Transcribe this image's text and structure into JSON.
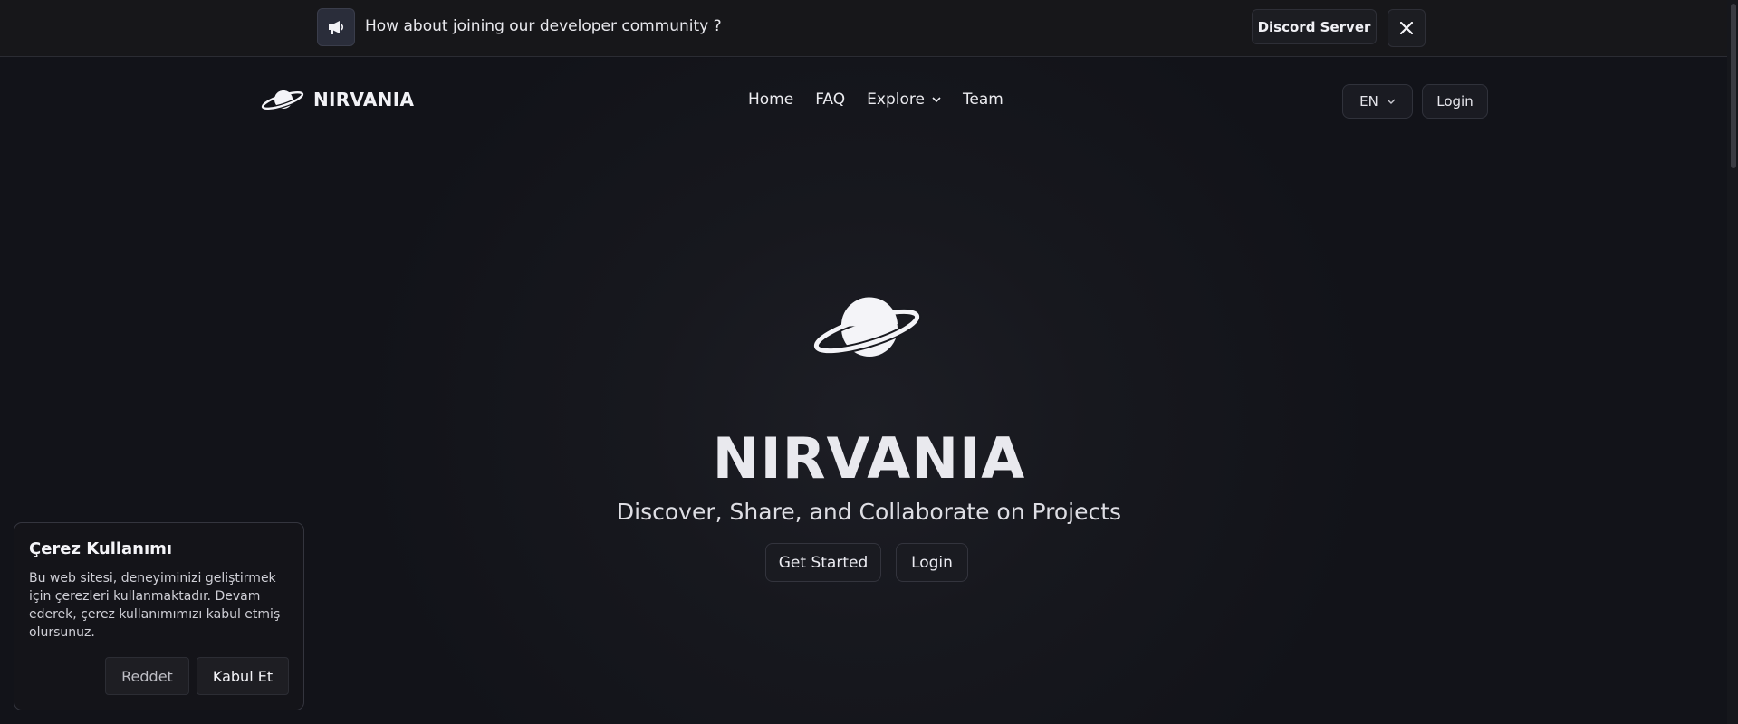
{
  "announcement": {
    "text": "How about joining our developer community ?",
    "discord_label": "Discord Server",
    "icon": "megaphone-icon"
  },
  "navbar": {
    "brand": "NIRVANIA",
    "links": [
      "Home",
      "FAQ",
      "Explore",
      "Team"
    ],
    "language": "EN",
    "login_label": "Login"
  },
  "hero": {
    "title": "NIRVANIA",
    "subtitle": "Discover, Share, and Collaborate on Projects",
    "get_started_label": "Get Started",
    "login_label": "Login"
  },
  "cookie": {
    "title": "Çerez Kullanımı",
    "text": "Bu web sitesi, deneyiminizi geliştirmek için çerezleri kullanmaktadır. Devam ederek, çerez kullanımımızı kabul etmiş olursunuz.",
    "reject_label": "Reddet",
    "accept_label": "Kabul Et"
  },
  "colors": {
    "background": "#121319",
    "panel": "#17171a",
    "text": "#e8e8ec"
  }
}
